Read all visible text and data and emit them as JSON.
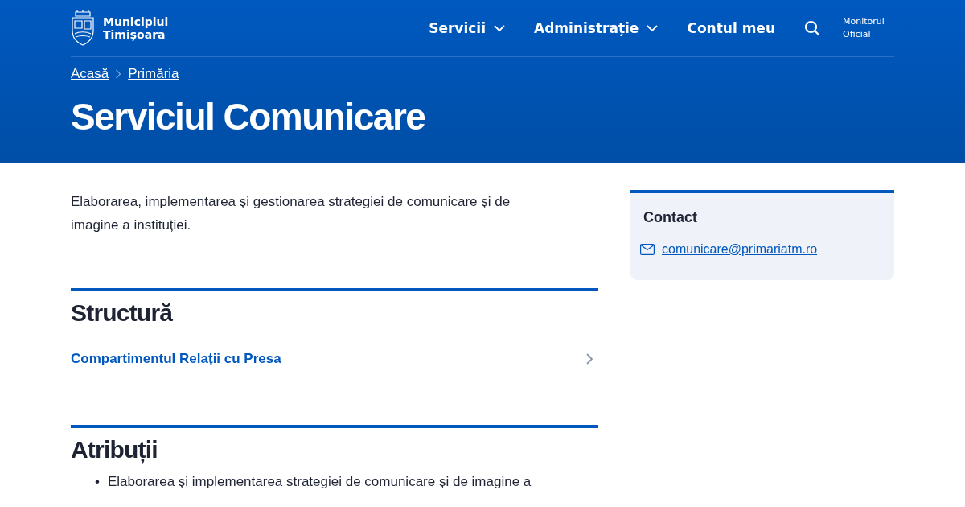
{
  "header": {
    "logo_text": [
      "Municipiul",
      "Timișoara"
    ],
    "nav": [
      {
        "label": "Servicii",
        "kind": "dropdown"
      },
      {
        "label": "Administrație",
        "kind": "dropdown"
      },
      {
        "label": "Contul meu",
        "kind": "link"
      }
    ],
    "monitor_link": [
      "Monitorul",
      "Oficial"
    ]
  },
  "breadcrumb": [
    "Acasă",
    "Primăria"
  ],
  "title": "Serviciul Comunicare",
  "intro": "Elaborarea, implementarea și gestionarea strategiei de comunicare și de imagine a instituției.",
  "sections": [
    {
      "heading": "Structură",
      "links": [
        "Compartimentul Relații cu Presa"
      ]
    },
    {
      "heading": "Atribuții",
      "bullets": [
        {
          "marker": "•",
          "text": "Elaborarea și implementarea strategiei de comunicare și de imagine a"
        }
      ]
    }
  ],
  "contact": {
    "heading": "Contact",
    "email": "comunicare@primariatm.ro"
  }
}
